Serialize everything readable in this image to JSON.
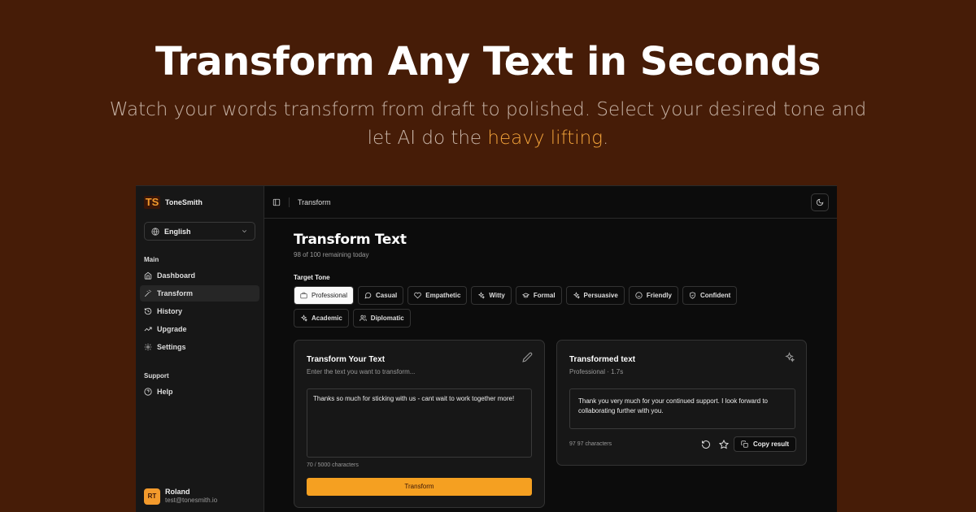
{
  "hero": {
    "title": "Transform Any Text in Seconds",
    "subtitle_part1": "Watch your words transform from draft to polished. Select your desired tone and let AI do the ",
    "subtitle_accent": "heavy lifting",
    "subtitle_part2": ".",
    "accent_color": "#f3a33a"
  },
  "app": {
    "brand": {
      "logo": "TS",
      "name": "ToneSmith"
    },
    "language": {
      "value": "English",
      "icon": "globe-icon"
    },
    "sidebar": {
      "main_label": "Main",
      "items": [
        {
          "label": "Dashboard",
          "icon": "home-icon",
          "active": false
        },
        {
          "label": "Transform",
          "icon": "wand-icon",
          "active": true
        },
        {
          "label": "History",
          "icon": "history-icon",
          "active": false
        },
        {
          "label": "Upgrade",
          "icon": "trending-up-icon",
          "active": false
        },
        {
          "label": "Settings",
          "icon": "gear-icon",
          "active": false
        }
      ],
      "support_label": "Support",
      "support_items": [
        {
          "label": "Help",
          "icon": "help-circle-icon"
        }
      ]
    },
    "user": {
      "initials": "RT",
      "name": "Roland",
      "email": "test@tonesmith.io"
    },
    "topbar": {
      "breadcrumb": "Transform"
    },
    "page": {
      "title": "Transform Text",
      "subtitle": "98 of 100 remaining today",
      "tone_label": "Target Tone",
      "tones": [
        {
          "label": "Professional",
          "icon": "briefcase-icon",
          "active": true
        },
        {
          "label": "Casual",
          "icon": "message-icon",
          "active": false
        },
        {
          "label": "Empathetic",
          "icon": "heart-icon",
          "active": false
        },
        {
          "label": "Witty",
          "icon": "sparkles-icon",
          "active": false
        },
        {
          "label": "Formal",
          "icon": "graduation-cap-icon",
          "active": false
        },
        {
          "label": "Persuasive",
          "icon": "sparkles-icon",
          "active": false
        },
        {
          "label": "Friendly",
          "icon": "smile-icon",
          "active": false
        },
        {
          "label": "Confident",
          "icon": "shield-check-icon",
          "active": false
        },
        {
          "label": "Academic",
          "icon": "sparkles-icon",
          "active": false
        },
        {
          "label": "Diplomatic",
          "icon": "users-icon",
          "active": false
        }
      ]
    },
    "input_card": {
      "title": "Transform Your Text",
      "subtitle": "Enter the text you want to transform...",
      "text": "Thanks so much for sticking with us - cant wait to work together more!",
      "counter": "70 / 5000 characters",
      "button": "Transform",
      "icon": "pencil-icon"
    },
    "output_card": {
      "title": "Transformed text",
      "subtitle": "Professional · 1.7s",
      "text": "Thank you very much for your continued support. I look forward to collaborating further with you.",
      "counter": "97 97 characters",
      "copy_label": "Copy result",
      "icon": "sparkles-icon"
    }
  }
}
